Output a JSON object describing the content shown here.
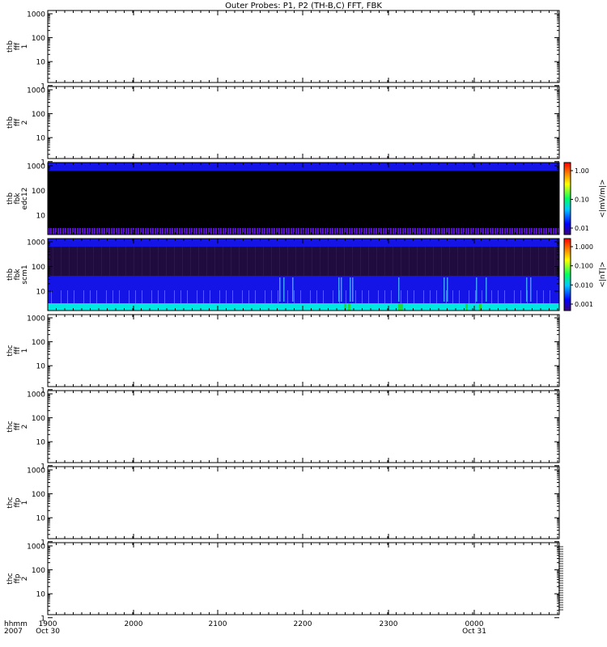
{
  "title": "Outer Probes: P1, P2 (TH-B,C) FFT, FBK",
  "chart_data": {
    "type": "heatmap",
    "title": "Outer Probes: P1, P2 (TH-B,C) FFT, FBK",
    "x_ticks": [
      {
        "line1": "1900",
        "line2": "Oct 30"
      },
      {
        "line1": "1900",
        "line2": ""
      },
      {
        "line1": "2000",
        "line2": ""
      },
      {
        "line1": "2100",
        "line2": ""
      },
      {
        "line1": "2200",
        "line2": ""
      },
      {
        "line1": "2300",
        "line2": ""
      },
      {
        "line1": "0000",
        "line2": "Oct 31"
      }
    ],
    "x_axis_label": {
      "line1": "hhmm",
      "line2": "2007"
    },
    "panels": [
      {
        "id": "thb-fff-1",
        "ylabel": [
          "thb",
          "fff",
          "1"
        ],
        "yticks": [
          "1000",
          "100",
          "10",
          "1"
        ],
        "spectrogram": false
      },
      {
        "id": "thb-fff-2",
        "ylabel": [
          "thb",
          "fff",
          "2"
        ],
        "yticks": [
          "1000",
          "100",
          "10",
          "1"
        ],
        "spectrogram": false
      },
      {
        "id": "thb-fbk-edc12",
        "ylabel": [
          "thb",
          "fbk",
          "edc12"
        ],
        "yticks": [
          "1000",
          "100",
          "10"
        ],
        "spectrogram": true,
        "colorbar": {
          "label": "<|mV/m|>",
          "ticks": [
            "1.00",
            "0.10",
            "0.01"
          ]
        }
      },
      {
        "id": "thb-fbk-scm1",
        "ylabel": [
          "thb",
          "fbk",
          "scm1"
        ],
        "yticks": [
          "1000",
          "100",
          "10"
        ],
        "spectrogram": true,
        "colorbar": {
          "label": "<|nT|>",
          "ticks": [
            "1.000",
            "0.100",
            "0.010",
            "0.001"
          ]
        }
      },
      {
        "id": "thc-fff-1",
        "ylabel": [
          "thc",
          "fff",
          "1"
        ],
        "yticks": [
          "1000",
          "100",
          "10",
          "1"
        ],
        "spectrogram": false
      },
      {
        "id": "thc-fff-2",
        "ylabel": [
          "thc",
          "fff",
          "2"
        ],
        "yticks": [
          "1000",
          "100",
          "10",
          "1"
        ],
        "spectrogram": false
      },
      {
        "id": "thc-ffp-1",
        "ylabel": [
          "thc",
          "ffp",
          "1"
        ],
        "yticks": [
          "1000",
          "100",
          "10",
          "1"
        ],
        "spectrogram": false
      },
      {
        "id": "thc-ffp-2",
        "ylabel": [
          "thc",
          "ffp",
          "2"
        ],
        "yticks": [
          "1000",
          "100",
          "10",
          "1"
        ],
        "spectrogram": false
      }
    ],
    "colors": {
      "background": "#ffffff",
      "axes": "#000000",
      "black_band": "#000000",
      "blue": "#1414e6",
      "violet": "#5a10c8",
      "cyan": "#00e8e0",
      "green": "#20d840",
      "dark_purple": "#1e0a3c"
    }
  }
}
